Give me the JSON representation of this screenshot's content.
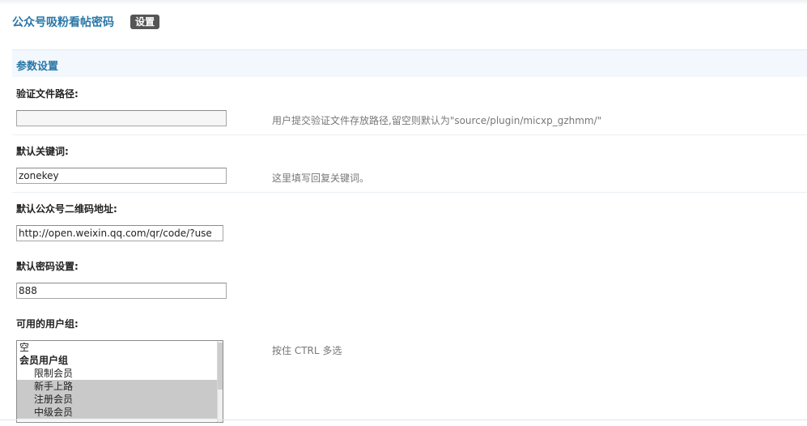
{
  "header": {
    "plugin_title": "公众号吸粉看帖密码",
    "tab_settings_label": "设置"
  },
  "section": {
    "title": "参数设置"
  },
  "fields": {
    "verify_path": {
      "label": "验证文件路径:",
      "value": "",
      "hint": "用户提交验证文件存放路径,留空则默认为\"source/plugin/micxp_gzhmm/\""
    },
    "default_keyword": {
      "label": "默认关键词:",
      "value": "zonekey",
      "hint": "这里填写回复关键词。"
    },
    "qrcode_url": {
      "label": "默认公众号二维码地址:",
      "value": "http://open.weixin.qq.com/qr/code/?use"
    },
    "default_password": {
      "label": "默认密码设置:",
      "value": "888"
    },
    "user_groups": {
      "label": "可用的用户组:",
      "hint": "按住 CTRL 多选",
      "options": [
        {
          "label": "空",
          "type": "option",
          "selected": false
        },
        {
          "label": "会员用户组",
          "type": "group",
          "selected": false
        },
        {
          "label": "限制会员",
          "type": "sub",
          "selected": false
        },
        {
          "label": "新手上路",
          "type": "sub",
          "selected": true
        },
        {
          "label": "注册会员",
          "type": "sub",
          "selected": true
        },
        {
          "label": "中级会员",
          "type": "sub",
          "selected": true
        }
      ]
    }
  },
  "colors": {
    "accent": "#2a77a8",
    "section_bg": "#f2f8fd",
    "selected_option_bg": "#c9c9c9"
  }
}
